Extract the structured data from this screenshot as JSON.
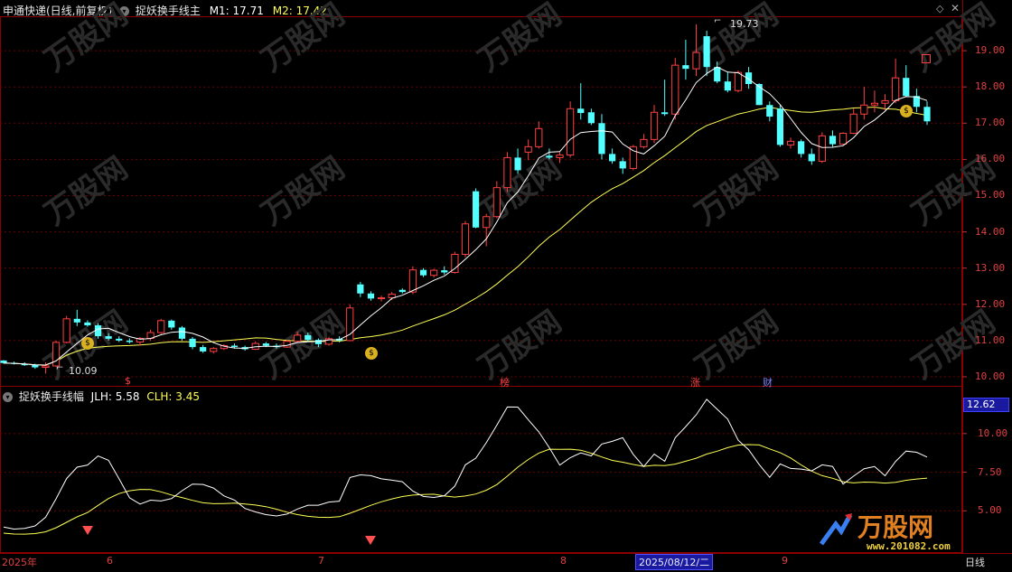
{
  "main_panel": {
    "title": "申通快递(日线,前复权)",
    "indicator": "捉妖换手线主",
    "m1_label": "M1: 17.71",
    "m2_label": "M2: 17.42",
    "high_label": "19.73",
    "low_label": "10.09",
    "y_ticks": [
      "19.00",
      "18.00",
      "17.00",
      "16.00",
      "15.00",
      "14.00",
      "13.00",
      "12.00",
      "11.00",
      "10.00"
    ],
    "markers": [
      "$",
      "榜",
      "涨",
      "财"
    ]
  },
  "sub_panel": {
    "indicator": "捉妖换手线幅",
    "jlh_label": "JLH: 5.58",
    "clh_label": "CLH: 3.45",
    "current_value": "12.62",
    "y_ticks": [
      "10.00",
      "7.50",
      "5.00"
    ]
  },
  "x_axis": {
    "labels": [
      "2025年",
      "6",
      "7",
      "8",
      "9"
    ],
    "selected_date": "2025/08/12/二",
    "period": "日线"
  },
  "watermark": {
    "brand": "万股网",
    "url": "www.201082.com"
  },
  "colors": {
    "up": "#ff4040",
    "down": "#54ffff",
    "ma1": "#ffffff",
    "ma2": "#ffff55",
    "grid": "#5a0000"
  },
  "chart_data": {
    "type": "candlestick",
    "ohlc": [
      [
        10.45,
        10.46,
        10.36,
        10.38
      ],
      [
        10.38,
        10.42,
        10.34,
        10.36
      ],
      [
        10.36,
        10.4,
        10.3,
        10.32
      ],
      [
        10.33,
        10.36,
        10.22,
        10.26
      ],
      [
        10.26,
        10.4,
        10.09,
        10.3
      ],
      [
        10.3,
        11.0,
        10.28,
        10.95
      ],
      [
        10.95,
        11.68,
        10.92,
        11.6
      ],
      [
        11.6,
        11.85,
        11.4,
        11.5
      ],
      [
        11.5,
        11.56,
        11.38,
        11.42
      ],
      [
        11.42,
        11.48,
        11.05,
        11.12
      ],
      [
        11.12,
        11.2,
        11.0,
        11.05
      ],
      [
        11.05,
        11.12,
        10.96,
        11.0
      ],
      [
        11.0,
        11.06,
        10.92,
        10.96
      ],
      [
        10.96,
        11.1,
        10.86,
        11.06
      ],
      [
        11.06,
        11.3,
        11.0,
        11.22
      ],
      [
        11.22,
        11.6,
        11.18,
        11.55
      ],
      [
        11.55,
        11.58,
        11.3,
        11.36
      ],
      [
        11.36,
        11.4,
        11.0,
        11.05
      ],
      [
        11.05,
        11.1,
        10.76,
        10.82
      ],
      [
        10.82,
        10.88,
        10.66,
        10.7
      ],
      [
        10.7,
        10.82,
        10.64,
        10.78
      ],
      [
        10.78,
        10.9,
        10.74,
        10.86
      ],
      [
        10.86,
        10.92,
        10.78,
        10.82
      ],
      [
        10.82,
        10.86,
        10.72,
        10.76
      ],
      [
        10.76,
        10.98,
        10.74,
        10.92
      ],
      [
        10.92,
        10.96,
        10.82,
        10.86
      ],
      [
        10.86,
        10.92,
        10.78,
        10.82
      ],
      [
        10.82,
        11.02,
        10.8,
        10.98
      ],
      [
        10.98,
        11.25,
        10.95,
        11.15
      ],
      [
        11.15,
        11.22,
        10.96,
        11.02
      ],
      [
        11.02,
        11.06,
        10.82,
        10.9
      ],
      [
        10.9,
        11.1,
        10.86,
        11.05
      ],
      [
        11.05,
        11.12,
        10.95,
        11.0
      ],
      [
        11.0,
        12.0,
        10.98,
        11.9
      ],
      [
        12.55,
        12.62,
        12.2,
        12.3
      ],
      [
        12.3,
        12.36,
        12.1,
        12.16
      ],
      [
        12.16,
        12.24,
        12.08,
        12.18
      ],
      [
        12.18,
        12.34,
        12.12,
        12.28
      ],
      [
        12.4,
        12.44,
        12.3,
        12.34
      ],
      [
        12.34,
        13.05,
        12.28,
        12.95
      ],
      [
        12.95,
        13.0,
        12.75,
        12.8
      ],
      [
        12.8,
        12.98,
        12.74,
        12.94
      ],
      [
        12.94,
        13.05,
        12.82,
        12.88
      ],
      [
        12.88,
        13.45,
        12.85,
        13.38
      ],
      [
        13.38,
        14.3,
        13.3,
        14.22
      ],
      [
        15.12,
        15.2,
        14.1,
        14.12
      ],
      [
        14.12,
        14.5,
        13.6,
        14.42
      ],
      [
        14.42,
        15.4,
        14.38,
        15.22
      ],
      [
        15.22,
        16.2,
        15.1,
        16.05
      ],
      [
        16.05,
        16.3,
        15.6,
        15.7
      ],
      [
        16.2,
        16.55,
        15.98,
        16.35
      ],
      [
        16.35,
        17.05,
        16.3,
        16.85
      ],
      [
        16.1,
        16.3,
        16.0,
        16.05
      ],
      [
        16.05,
        16.2,
        15.9,
        16.12
      ],
      [
        16.12,
        17.6,
        16.05,
        17.4
      ],
      [
        17.4,
        18.1,
        17.1,
        17.28
      ],
      [
        17.3,
        17.4,
        16.95,
        17.0
      ],
      [
        17.0,
        17.25,
        16.0,
        16.15
      ],
      [
        16.15,
        16.3,
        15.88,
        15.95
      ],
      [
        15.95,
        16.05,
        15.6,
        15.75
      ],
      [
        15.75,
        16.4,
        15.7,
        16.35
      ],
      [
        16.35,
        16.7,
        16.3,
        16.55
      ],
      [
        16.55,
        17.5,
        16.45,
        17.3
      ],
      [
        17.3,
        18.2,
        17.2,
        17.25
      ],
      [
        17.25,
        18.8,
        17.1,
        18.6
      ],
      [
        18.6,
        19.3,
        18.2,
        18.5
      ],
      [
        18.5,
        19.73,
        18.3,
        18.95
      ],
      [
        19.4,
        19.55,
        18.3,
        18.55
      ],
      [
        18.55,
        18.7,
        18.1,
        18.15
      ],
      [
        18.15,
        18.4,
        17.85,
        17.9
      ],
      [
        17.9,
        18.45,
        17.85,
        18.4
      ],
      [
        18.4,
        18.55,
        17.95,
        18.08
      ],
      [
        18.08,
        18.1,
        17.5,
        17.5
      ],
      [
        17.5,
        17.6,
        17.05,
        17.18
      ],
      [
        17.4,
        17.5,
        16.35,
        16.4
      ],
      [
        16.4,
        16.6,
        16.3,
        16.5
      ],
      [
        16.5,
        16.55,
        16.05,
        16.15
      ],
      [
        16.15,
        16.3,
        15.85,
        15.95
      ],
      [
        15.95,
        16.75,
        15.9,
        16.65
      ],
      [
        16.65,
        16.8,
        16.35,
        16.42
      ],
      [
        16.42,
        16.75,
        16.4,
        16.72
      ],
      [
        16.72,
        17.4,
        16.7,
        17.25
      ],
      [
        17.25,
        18.0,
        17.1,
        17.5
      ],
      [
        17.5,
        17.9,
        17.3,
        17.55
      ],
      [
        17.55,
        17.8,
        17.35,
        17.62
      ],
      [
        17.62,
        18.78,
        17.55,
        18.25
      ],
      [
        18.25,
        18.6,
        17.72,
        17.75
      ],
      [
        17.75,
        17.95,
        17.3,
        17.45
      ],
      [
        17.45,
        17.6,
        16.95,
        17.05
      ]
    ],
    "ylim": [
      9.8,
      20.0
    ],
    "sub_ylim": [
      2.5,
      12.8
    ]
  }
}
